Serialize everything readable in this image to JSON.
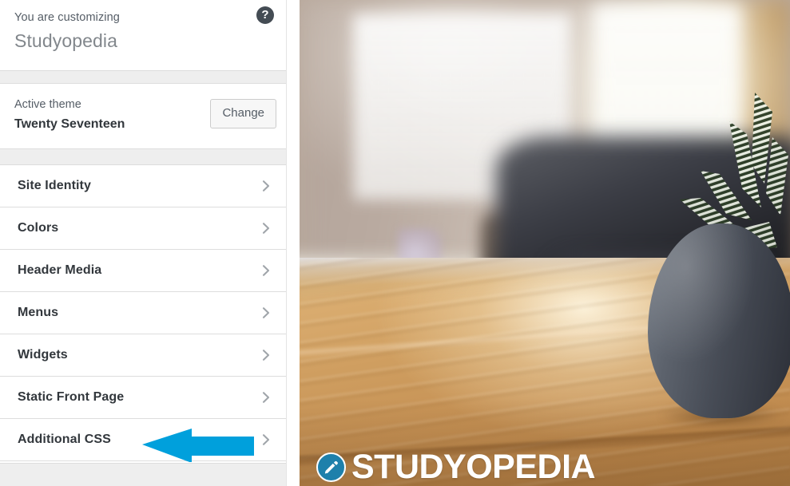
{
  "customizer": {
    "header": {
      "eyebrow": "You are customizing",
      "site_title": "Studyopedia",
      "help_icon": "help-icon",
      "help_label": "?"
    },
    "theme": {
      "label": "Active theme",
      "name": "Twenty Seventeen",
      "change_button": "Change"
    },
    "sections": [
      {
        "label": "Site Identity",
        "chevron": "chevron-right-icon"
      },
      {
        "label": "Colors",
        "chevron": "chevron-right-icon"
      },
      {
        "label": "Header Media",
        "chevron": "chevron-right-icon"
      },
      {
        "label": "Menus",
        "chevron": "chevron-right-icon"
      },
      {
        "label": "Widgets",
        "chevron": "chevron-right-icon"
      },
      {
        "label": "Static Front Page",
        "chevron": "chevron-right-icon"
      },
      {
        "label": "Additional CSS",
        "chevron": "chevron-right-icon"
      }
    ],
    "annotation": {
      "name": "arrow-pointing-to-additional-css",
      "color": "#00a0dc",
      "direction": "left"
    }
  },
  "preview": {
    "description": "Blurred interior photo: sunlit window, dark sofa, wooden table with a dark gray pot holding a zebra haworthia plant",
    "watermark": {
      "text": "STUDYOPEDIA",
      "badge_icon": "pencil-icon",
      "badge_color": "#1e80ab",
      "text_color": "#ffffff"
    }
  },
  "colors": {
    "sidebar_bg": "#ffffff",
    "band_gray": "#eeeeee",
    "divider": "#dddddd",
    "text_dark": "#32373c",
    "text_muted": "#555d66",
    "title_muted": "#82878c",
    "accent_blue": "#00a0dc"
  }
}
